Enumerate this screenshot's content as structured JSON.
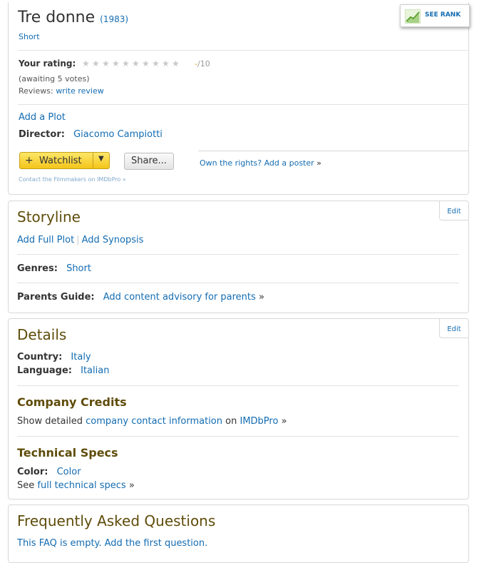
{
  "overview": {
    "title": "Tre donne",
    "year": "(1983)",
    "type": "Short",
    "rating_label": "Your rating:",
    "rating_dash": "-",
    "rating_scale": "/10",
    "votes": "(awaiting 5 votes)",
    "reviews_label": "Reviews:",
    "write_review": "write review",
    "add_plot": "Add a Plot",
    "director_label": "Director:",
    "director": "Giacomo Campiotti",
    "watchlist_plus": "+",
    "watchlist_label": "Watchlist",
    "share_label": "Share...",
    "own_rights": "Own the rights? Add a poster",
    "own_rights_arrow": "»",
    "contact": "Contact the Filmmakers on IMDbPro »",
    "see_rank": "SEE RANK",
    "stars_count": 10
  },
  "storyline": {
    "heading": "Storyline",
    "edit": "Edit",
    "add_full_plot": "Add Full Plot",
    "separator": "|",
    "add_synopsis": "Add Synopsis",
    "genres_label": "Genres:",
    "genre": "Short",
    "parents_label": "Parents Guide:",
    "parents_link": "Add content advisory for parents",
    "arrow": "»"
  },
  "details": {
    "heading": "Details",
    "edit": "Edit",
    "country_label": "Country:",
    "country": "Italy",
    "language_label": "Language:",
    "language": "Italian",
    "company_heading": "Company Credits",
    "company_prefix": "Show detailed",
    "company_link": "company contact information",
    "company_on": "on",
    "imdbpro": "IMDbPro",
    "arrow": "»",
    "tech_heading": "Technical Specs",
    "color_label": "Color:",
    "color": "Color",
    "see_prefix": "See",
    "full_tech_link": "full technical specs",
    "arrow2": "»"
  },
  "faq": {
    "heading": "Frequently Asked Questions",
    "empty_text": "This FAQ is empty. Add the first question."
  },
  "colors": {
    "link": "#136cb2",
    "heading": "#5f4c0a",
    "watchlist": "#f4c51a"
  }
}
